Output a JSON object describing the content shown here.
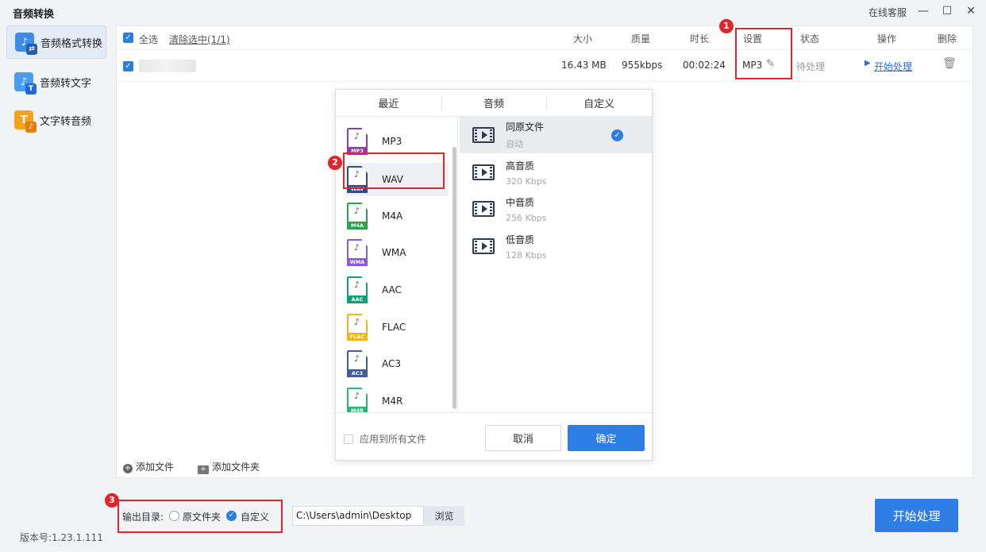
{
  "app": {
    "title": "音频转换",
    "support": "在线客服",
    "version": "版本号:1.23.1.111"
  },
  "sidebar": {
    "items": [
      {
        "label": "音频格式转换",
        "icon": "music-convert-icon",
        "active": true
      },
      {
        "label": "音频转文字",
        "icon": "audio-to-text-icon",
        "active": false
      },
      {
        "label": "文字转音频",
        "icon": "text-to-audio-icon",
        "active": false
      }
    ]
  },
  "table": {
    "select_all": "全选",
    "clear_selection": "清除选中(1/1)",
    "columns": {
      "size": "大小",
      "quality": "质量",
      "duration": "时长",
      "settings": "设置",
      "status": "状态",
      "action": "操作",
      "delete": "删除"
    },
    "rows": [
      {
        "size": "16.43 MB",
        "quality": "955kbps",
        "duration": "00:02:24",
        "format": "MP3",
        "status": "待处理",
        "action": "开始处理"
      }
    ]
  },
  "add": {
    "file": "添加文件",
    "folder": "添加文件夹"
  },
  "popup": {
    "tabs": [
      "最近",
      "音频",
      "自定义"
    ],
    "formats": [
      {
        "name": "MP3",
        "color": "#8e3bb5"
      },
      {
        "name": "WAV",
        "color": "#2c4f8c"
      },
      {
        "name": "M4A",
        "color": "#2aa34a"
      },
      {
        "name": "WMA",
        "color": "#8a5bd6"
      },
      {
        "name": "AAC",
        "color": "#12a07a"
      },
      {
        "name": "FLAC",
        "color": "#f2b51c"
      },
      {
        "name": "AC3",
        "color": "#3f5f9a"
      },
      {
        "name": "M4R",
        "color": "#2bb37a"
      }
    ],
    "selected_format": "WAV",
    "qualities": [
      {
        "title": "同原文件",
        "sub": "自动",
        "selected": true
      },
      {
        "title": "高音质",
        "sub": "320 Kbps",
        "selected": false
      },
      {
        "title": "中音质",
        "sub": "256 Kbps",
        "selected": false
      },
      {
        "title": "低音质",
        "sub": "128 Kbps",
        "selected": false
      }
    ],
    "apply_all": "应用到所有文件",
    "cancel": "取消",
    "confirm": "确定"
  },
  "output": {
    "label": "输出目录:",
    "option_original": "原文件夹",
    "option_custom": "自定义",
    "path": "C:\\Users\\admin\\Desktop",
    "browse": "浏览",
    "start": "开始处理"
  },
  "annotations": [
    "1",
    "2",
    "3"
  ],
  "colors": {
    "accent": "#2f7ee6",
    "annotation": "#e0252b"
  }
}
